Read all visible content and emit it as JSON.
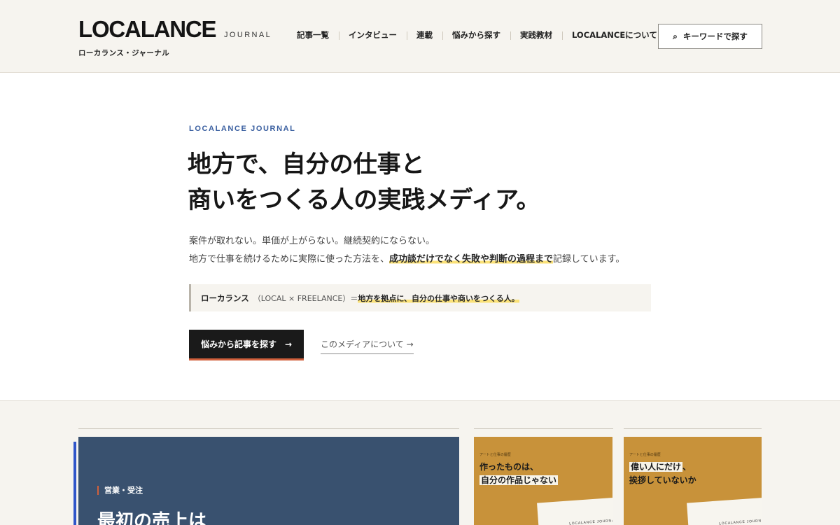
{
  "header": {
    "logo_main": "LOCALANCE",
    "logo_sub": "JOURNAL",
    "logo_kana": "ローカランス・ジャーナル",
    "nav": [
      "記事一覧",
      "インタビュー",
      "連載",
      "悩みから探す",
      "実践教材",
      "LOCALANCEについて"
    ],
    "search_label": "キーワードで探す",
    "search_icon": "⌕"
  },
  "hero": {
    "eyebrow": "LOCALANCE JOURNAL",
    "title_lines": [
      "地方で、自分の仕事と",
      "商いをつくる人の実践メディア。"
    ],
    "lead_line1": "案件が取れない。単価が上がらない。継続契約にならない。",
    "lead_line2_before": "地方で仕事を続けるために実際に使った方法を、",
    "lead_line2_mark": "成功談だけでなく失敗や判断の過程まで",
    "lead_line2_after": "記録しています。",
    "def_term": "ローカランス",
    "def_paren": "（LOCAL × FREELANCE）＝",
    "def_mark": "地方を拠点に、自分の仕事や商いをつくる人。",
    "cta_primary": "悩みから記事を探す",
    "cta_primary_arrow": "→",
    "cta_secondary": "このメディアについて →"
  },
  "featured": {
    "category": "営業・受注",
    "title": "最初の売上は"
  },
  "cards": [
    {
      "series": "アートと仕事の履歴",
      "title_line1": "作ったものは、",
      "title_line2": "自分の作品じゃない",
      "paper_label": "LOCALANCE JOURNAL"
    },
    {
      "series": "アートと仕事の履歴",
      "title_line1_hl": "偉い人にだけ",
      "title_line1_rest": "、",
      "title_line2": "挨拶していないか",
      "paper_label": "LOCALANCE JOURNAL"
    }
  ],
  "colors": {
    "header_bg": "#f6f4ef",
    "accent_blue": "#3a5fa0",
    "cta_bg": "#1a1a1a",
    "cta_underline": "#d0603c",
    "highlight": "#fbe278",
    "feature_bg": "#39516f",
    "card_bg": "#c8923a"
  }
}
